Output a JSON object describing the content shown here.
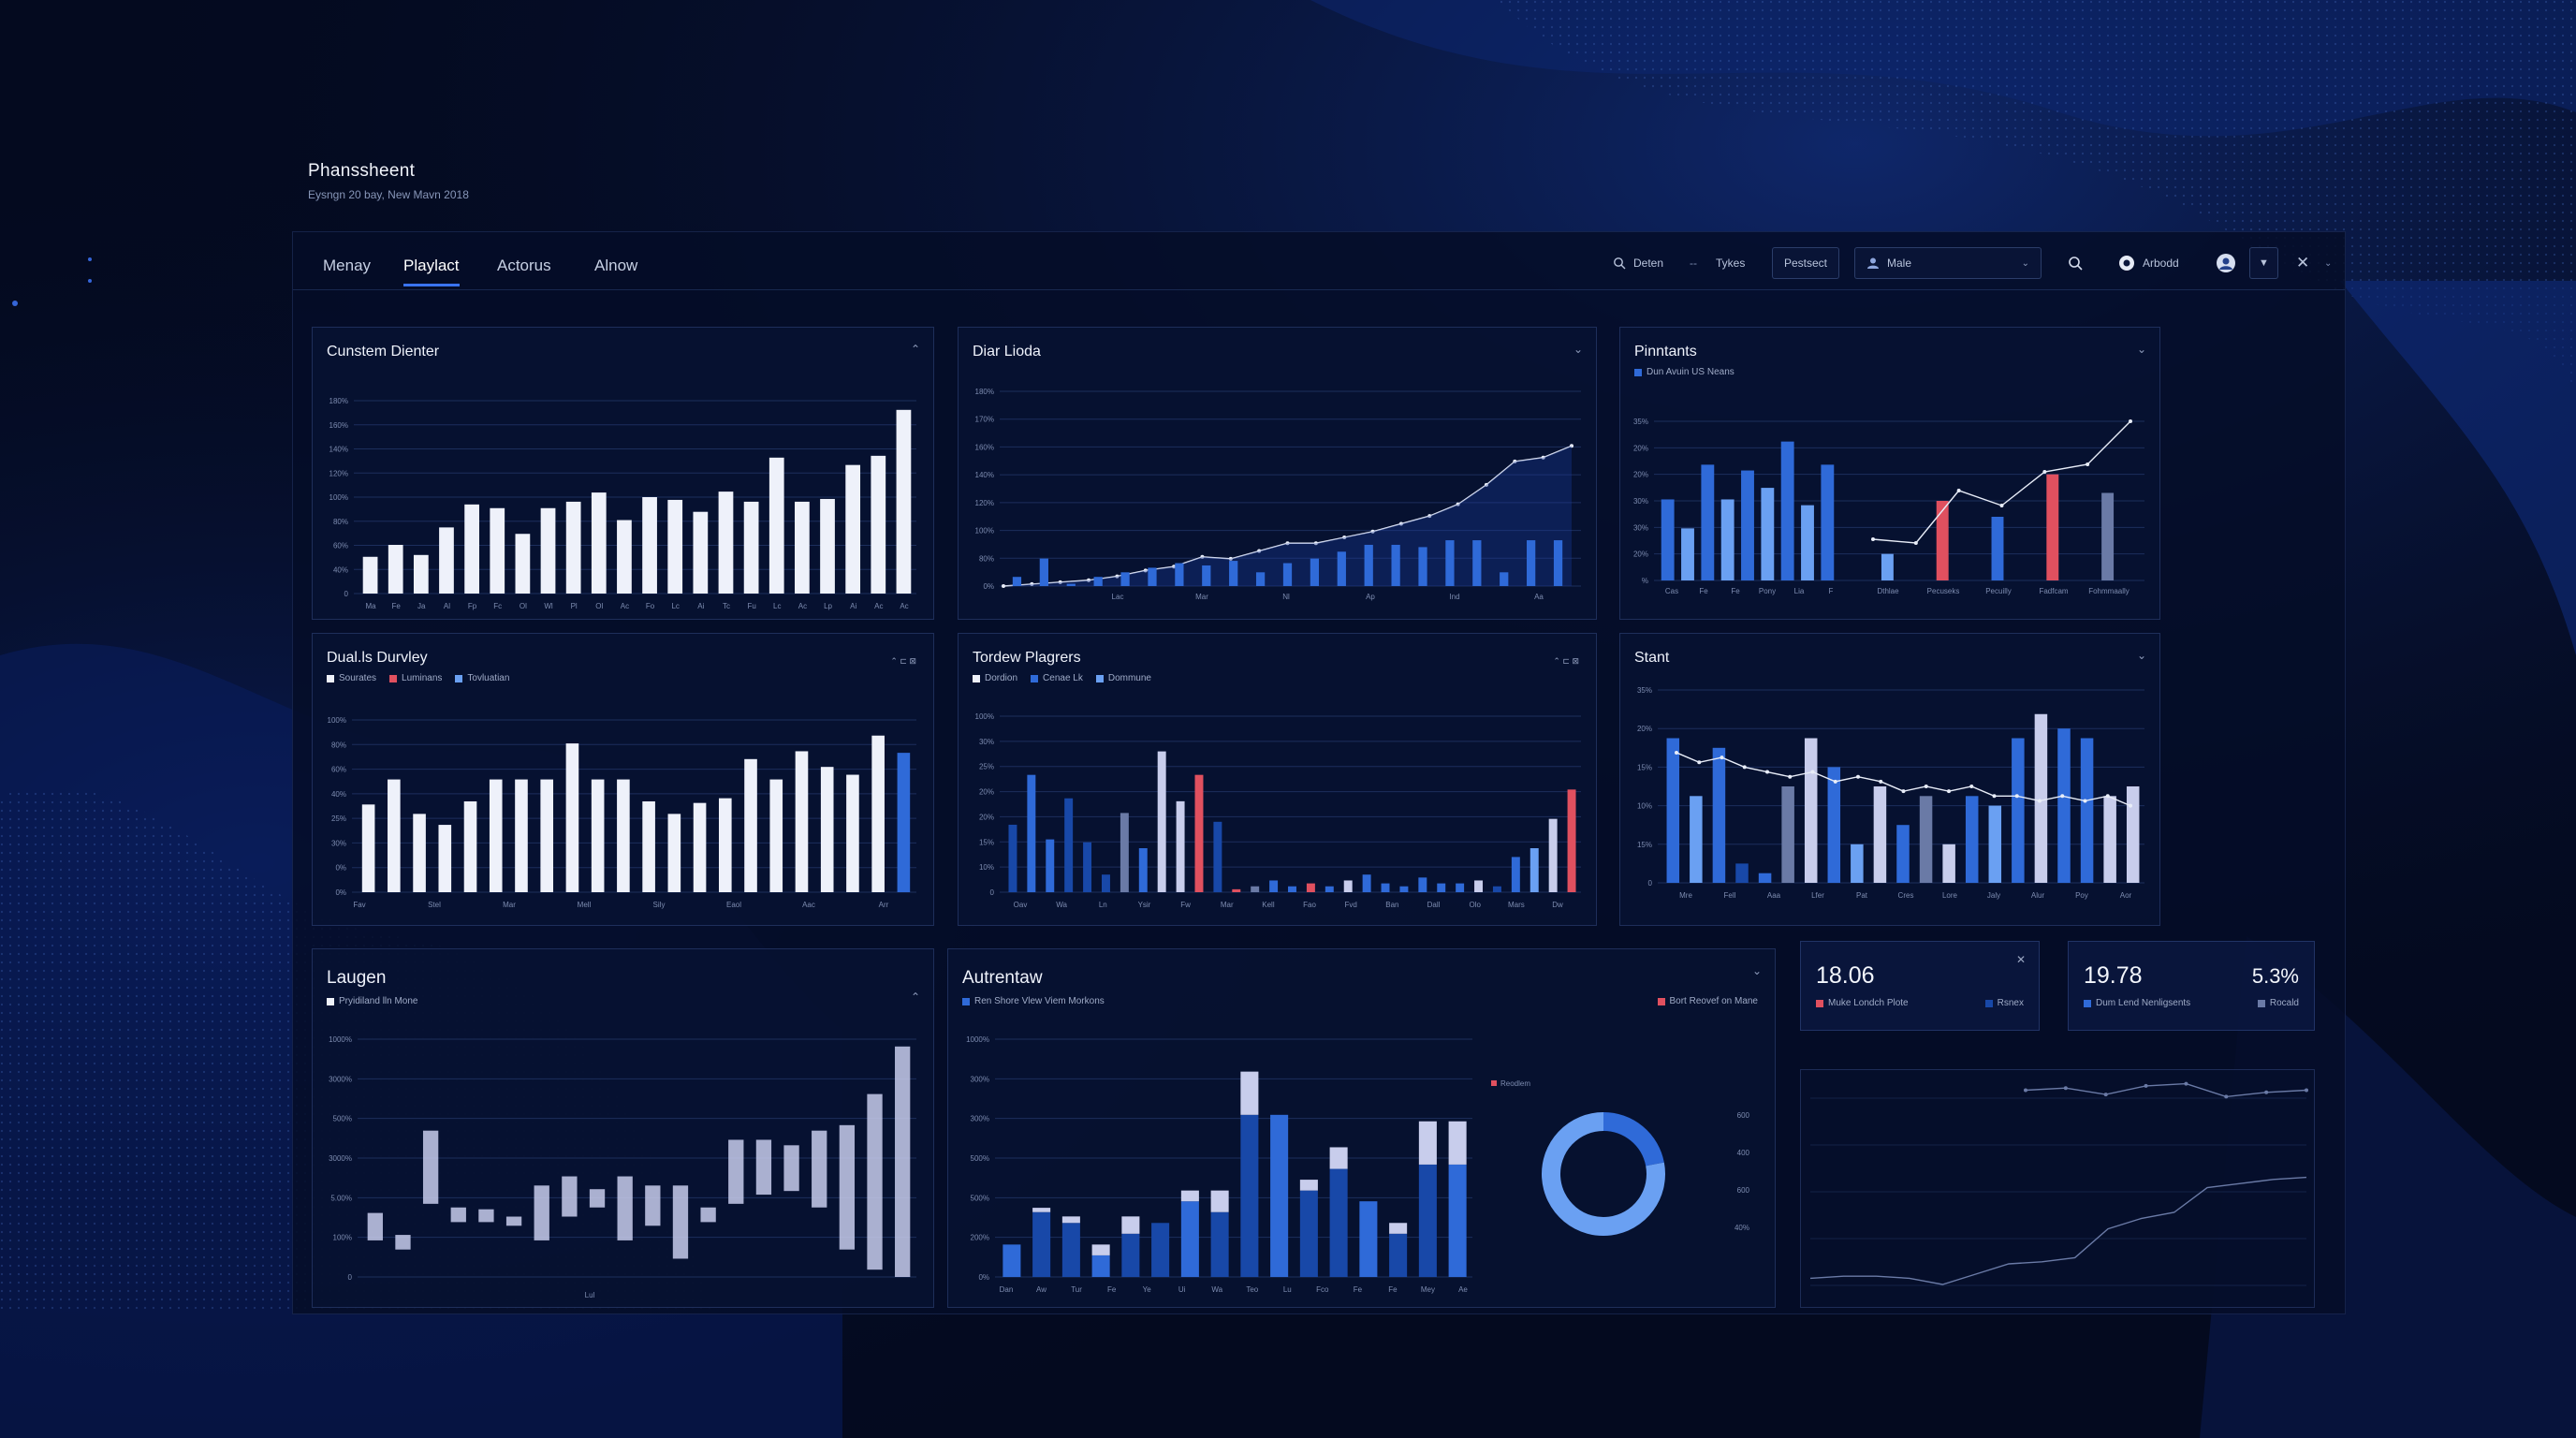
{
  "app": {
    "title": "Phanssheent",
    "subtitle": "Eysngn 20 bay, New Mavn 2018"
  },
  "nav": {
    "tabs": [
      {
        "label": "Menay"
      },
      {
        "label": "Playlact",
        "active": true
      },
      {
        "label": "Actorus"
      },
      {
        "label": "Alnow"
      }
    ]
  },
  "toolbar": {
    "filter_label": "Deten",
    "separator": "--",
    "types_label": "Tykes",
    "protect_button": "Pestsect",
    "user_select": "Male",
    "account_label": "Arbodd"
  },
  "colors": {
    "white_bar": "#eef1fa",
    "blue": "#2f6ad8",
    "light_blue": "#6aa0f2",
    "navy": "#1848a8",
    "red": "#e0505f",
    "lavender": "#c8cdec",
    "grey_blue": "#6a7aa6",
    "line": "#e8edf8",
    "grid": "#1c2e5c",
    "axis_text": "#7d8cb0"
  },
  "panels": {
    "p1": {
      "title": "Cunstem Dienter",
      "chart_data": {
        "type": "bar",
        "yticks": [
          "180%",
          "160%",
          "140%",
          "120%",
          "100%",
          "80%",
          "60%",
          "40%",
          "0"
        ],
        "categories": [
          "Ma",
          "Fe",
          "Ja",
          "Al",
          "Fp",
          "Fc",
          "Ol",
          "Wl",
          "Pl",
          "Ol",
          "Ac",
          "Fo",
          "Lc",
          "Ai",
          "Tc",
          "Fu",
          "Lc",
          "Ac",
          "Lp",
          "Ai",
          "Ac",
          "Ac"
        ],
        "values": [
          40,
          53,
          42,
          72,
          97,
          93,
          65,
          93,
          100,
          110,
          80,
          105,
          102,
          89,
          111,
          100,
          148,
          100,
          103,
          140,
          150,
          200
        ],
        "ylim": [
          0,
          210
        ]
      }
    },
    "p2": {
      "title": "Diar Lioda",
      "chart_data": {
        "type": "bar+line",
        "yticks": [
          "180%",
          "170%",
          "160%",
          "140%",
          "120%",
          "100%",
          "80%",
          "0%"
        ],
        "categories": [
          "Lac",
          "Mar",
          "Nl",
          "Ap",
          "Ind",
          "Aa"
        ],
        "bar_values": [
          4,
          12,
          1,
          4,
          6,
          8,
          10,
          9,
          11,
          6,
          10,
          12,
          15,
          18,
          18,
          17,
          20,
          20,
          6,
          20,
          20
        ],
        "line_values": [
          0,
          1,
          2,
          3,
          5,
          8,
          10,
          15,
          14,
          18,
          22,
          22,
          25,
          28,
          32,
          36,
          42,
          52,
          64,
          66,
          72
        ],
        "ylim": [
          0,
          100
        ]
      }
    },
    "p3": {
      "title": "Pinntants",
      "legend": "Dun Avuin US Neans",
      "chart_data": {
        "type": "bar+line",
        "yticks": [
          "35%",
          "20%",
          "20%",
          "30%",
          "30%",
          "20%",
          "%"
        ],
        "left_categories": [
          "Cas",
          "Fe",
          "Fe",
          "Pony",
          "Lia",
          "F"
        ],
        "left_values": [
          28,
          18,
          40,
          28,
          38,
          32,
          48,
          26,
          40
        ],
        "right_categories": [
          "Dthlae",
          "Pecuseks",
          "Pecuilly",
          "Fadfcam",
          "Fohmmaally"
        ],
        "right_values": [
          10,
          30,
          24,
          40,
          33
        ],
        "right_colors": [
          "light_blue",
          "red",
          "blue",
          "red",
          "grey_blue"
        ],
        "line_values": [
          22,
          20,
          48,
          40,
          58,
          62,
          85
        ],
        "ylim": [
          0,
          100
        ]
      }
    },
    "p4": {
      "title": "Dual.ls Durvley",
      "controls": "⌃ ⊏ ⊠",
      "legend": [
        {
          "label": "Sourates",
          "color": "white_bar"
        },
        {
          "label": "Luminans",
          "color": "red"
        },
        {
          "label": "Tovluatian",
          "color": "light_blue"
        }
      ],
      "chart_data": {
        "type": "bar",
        "yticks": [
          "100%",
          "80%",
          "60%",
          "40%",
          "25%",
          "30%",
          "0%",
          "0%"
        ],
        "categories": [
          "Fav",
          "Stel",
          "Mar",
          "Mell",
          "Sily",
          "Eaol",
          "Aac",
          "Arr"
        ],
        "values": [
          56,
          72,
          50,
          43,
          58,
          72,
          72,
          72,
          95,
          72,
          72,
          58,
          50,
          57,
          60,
          85,
          72,
          90,
          80,
          75,
          100,
          89
        ],
        "ylim": [
          0,
          110
        ]
      }
    },
    "p5": {
      "title": "Tordew Plagrers",
      "controls": "⌃ ⊏ ⊠",
      "legend": [
        {
          "label": "Dordion",
          "color": "white_bar"
        },
        {
          "label": "Cenae Lk",
          "color": "blue"
        },
        {
          "label": "Dommune",
          "color": "light_blue"
        }
      ],
      "chart_data": {
        "type": "bar",
        "yticks": [
          "100%",
          "30%",
          "25%",
          "20%",
          "20%",
          "15%",
          "10%",
          "0"
        ],
        "categories": [
          "Oav",
          "Wa",
          "Ln",
          "Ysir",
          "Fw",
          "Mar",
          "Kell",
          "Fao",
          "Fvd",
          "Ban",
          "Dall",
          "Olo",
          "Mars",
          "Dw"
        ],
        "values": [
          23,
          40,
          18,
          32,
          17,
          6,
          27,
          15,
          48,
          31,
          40,
          24,
          1,
          2,
          4,
          2,
          3,
          2,
          4,
          6,
          3,
          2,
          5,
          3,
          3,
          4,
          2,
          12,
          15,
          25,
          35
        ],
        "colors": [
          "navy",
          "blue",
          "blue",
          "navy",
          "navy",
          "navy",
          "grey_blue",
          "blue",
          "lavender",
          "lavender",
          "red",
          "navy",
          "red",
          "grey_blue",
          "blue",
          "blue",
          "red",
          "blue",
          "lavender",
          "blue",
          "blue",
          "blue",
          "blue",
          "blue",
          "blue",
          "lavender",
          "navy",
          "blue",
          "light_blue",
          "lavender",
          "red"
        ],
        "ylim": [
          0,
          60
        ]
      }
    },
    "p6": {
      "title": "Stant",
      "chart_data": {
        "type": "bar+line",
        "yticks": [
          "35%",
          "20%",
          "15%",
          "10%",
          "15%",
          "0"
        ],
        "categories": [
          "Mre",
          "Fell",
          "Aaa",
          "Lfer",
          "Pat",
          "Cres",
          "Lore",
          "Jaly",
          "Alur",
          "Poy",
          "Aor"
        ],
        "values": [
          30,
          18,
          28,
          4,
          2,
          20,
          30,
          24,
          8,
          20,
          12,
          18,
          8,
          18,
          16,
          30,
          35,
          32,
          30,
          18,
          20
        ],
        "line_values": [
          27,
          25,
          26,
          24,
          23,
          22,
          23,
          21,
          22,
          21,
          19,
          20,
          19,
          20,
          18,
          18,
          17,
          18,
          17,
          18,
          16
        ]
      }
    },
    "p7": {
      "title": "Laugen",
      "legend": "Pryidiland lln Mone",
      "chart_data": {
        "type": "floating_bar",
        "yticks": [
          "1000%",
          "3000%",
          "500%",
          "3000%",
          "5.00%",
          "100%",
          "0"
        ],
        "xlabel": "Lul",
        "ranges": [
          [
            20,
            35
          ],
          [
            15,
            23
          ],
          [
            40,
            80
          ],
          [
            30,
            38
          ],
          [
            30,
            37
          ],
          [
            28,
            33
          ],
          [
            20,
            50
          ],
          [
            33,
            55
          ],
          [
            38,
            48
          ],
          [
            20,
            55
          ],
          [
            28,
            50
          ],
          [
            10,
            50
          ],
          [
            30,
            38
          ],
          [
            40,
            75
          ],
          [
            45,
            75
          ],
          [
            47,
            72
          ],
          [
            38,
            80
          ],
          [
            15,
            83
          ],
          [
            4,
            100
          ],
          [
            0,
            126
          ]
        ],
        "ylim": [
          0,
          130
        ]
      }
    },
    "p8": {
      "title": "Autrentaw",
      "legend": "Ren Shore Vlew Viem Morkons",
      "legend_right": "Bort Reovef on Mane",
      "donut_label": "Reodlem",
      "yticks": [
        "1000%",
        "300%",
        "300%",
        "500%",
        "500%",
        "200%",
        "0%"
      ],
      "categories": [
        "Dan",
        "Aw",
        "Tur",
        "Fe",
        "Ye",
        "Ui",
        "Wa",
        "Teo",
        "Lu",
        "Fco",
        "Fe",
        "Fe",
        "Mey",
        "Ae"
      ],
      "right_ticks": [
        "600",
        "400",
        "600",
        "40%"
      ],
      "chart_data": {
        "type": "stacked_bar",
        "bottom": [
          15,
          30,
          25,
          10,
          20,
          25,
          35,
          30,
          75,
          75,
          40,
          50,
          35,
          20,
          52,
          52
        ],
        "top": [
          0,
          2,
          3,
          5,
          8,
          0,
          5,
          10,
          20,
          0,
          5,
          10,
          0,
          5,
          20,
          20
        ],
        "ylim": [
          0,
          110
        ]
      },
      "donut_data": {
        "type": "pie",
        "values": [
          22,
          78
        ],
        "colors": [
          "blue",
          "light_blue"
        ]
      }
    },
    "k1": {
      "value": "18.06",
      "label_left": "Muke Londch Plote",
      "label_right": "Rsnex"
    },
    "k2": {
      "value": "19.78",
      "value2": "5.3%",
      "label_left": "Dum Lend Nenligsents",
      "label_right": "Rocald"
    },
    "p9": {
      "chart_data": {
        "type": "line",
        "series": [
          {
            "values": [
              8,
              9,
              9,
              8,
              5,
              10,
              15,
              16,
              18,
              32,
              37,
              40,
              52,
              54,
              56,
              57
            ]
          },
          {
            "values": [
              95,
              96,
              93,
              97,
              98,
              92,
              94,
              95
            ]
          }
        ],
        "ylim": [
          0,
          100
        ]
      }
    }
  }
}
